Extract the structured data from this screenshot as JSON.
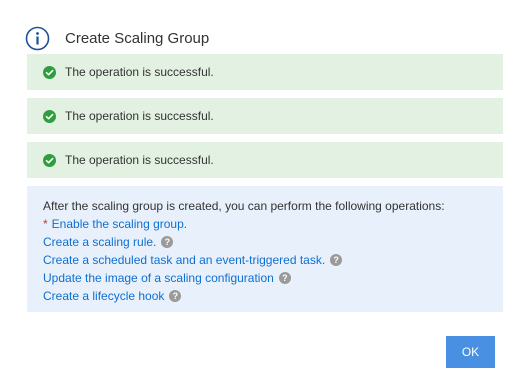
{
  "dialog": {
    "title": "Create Scaling Group",
    "success_messages": [
      "The operation is successful.",
      "The operation is successful.",
      "The operation is successful."
    ],
    "operations": {
      "intro": "After the scaling group is created, you can perform the following operations:",
      "items": [
        {
          "label": "Enable the scaling group.",
          "required": true,
          "has_help": false
        },
        {
          "label": "Create a scaling rule.",
          "required": false,
          "has_help": true
        },
        {
          "label": "Create a scheduled task and an event-triggered task.",
          "required": false,
          "has_help": true
        },
        {
          "label": "Update the image of a scaling configuration",
          "required": false,
          "has_help": true
        },
        {
          "label": "Create a lifecycle hook",
          "required": false,
          "has_help": true
        }
      ],
      "required_marker": "*",
      "help_glyph": "?"
    },
    "ok_label": "OK"
  },
  "colors": {
    "info_icon": "#1f4e9a",
    "success_bg": "#e2f1e1",
    "success_icon": "#2f9e3f",
    "ops_bg": "#e8f0fb",
    "link": "#0f6fd1",
    "required": "#e0301e",
    "ok_button": "#4a90e2"
  },
  "icons": {
    "header": "info-circle-icon",
    "success": "check-circle-icon",
    "help": "question-circle-icon"
  }
}
